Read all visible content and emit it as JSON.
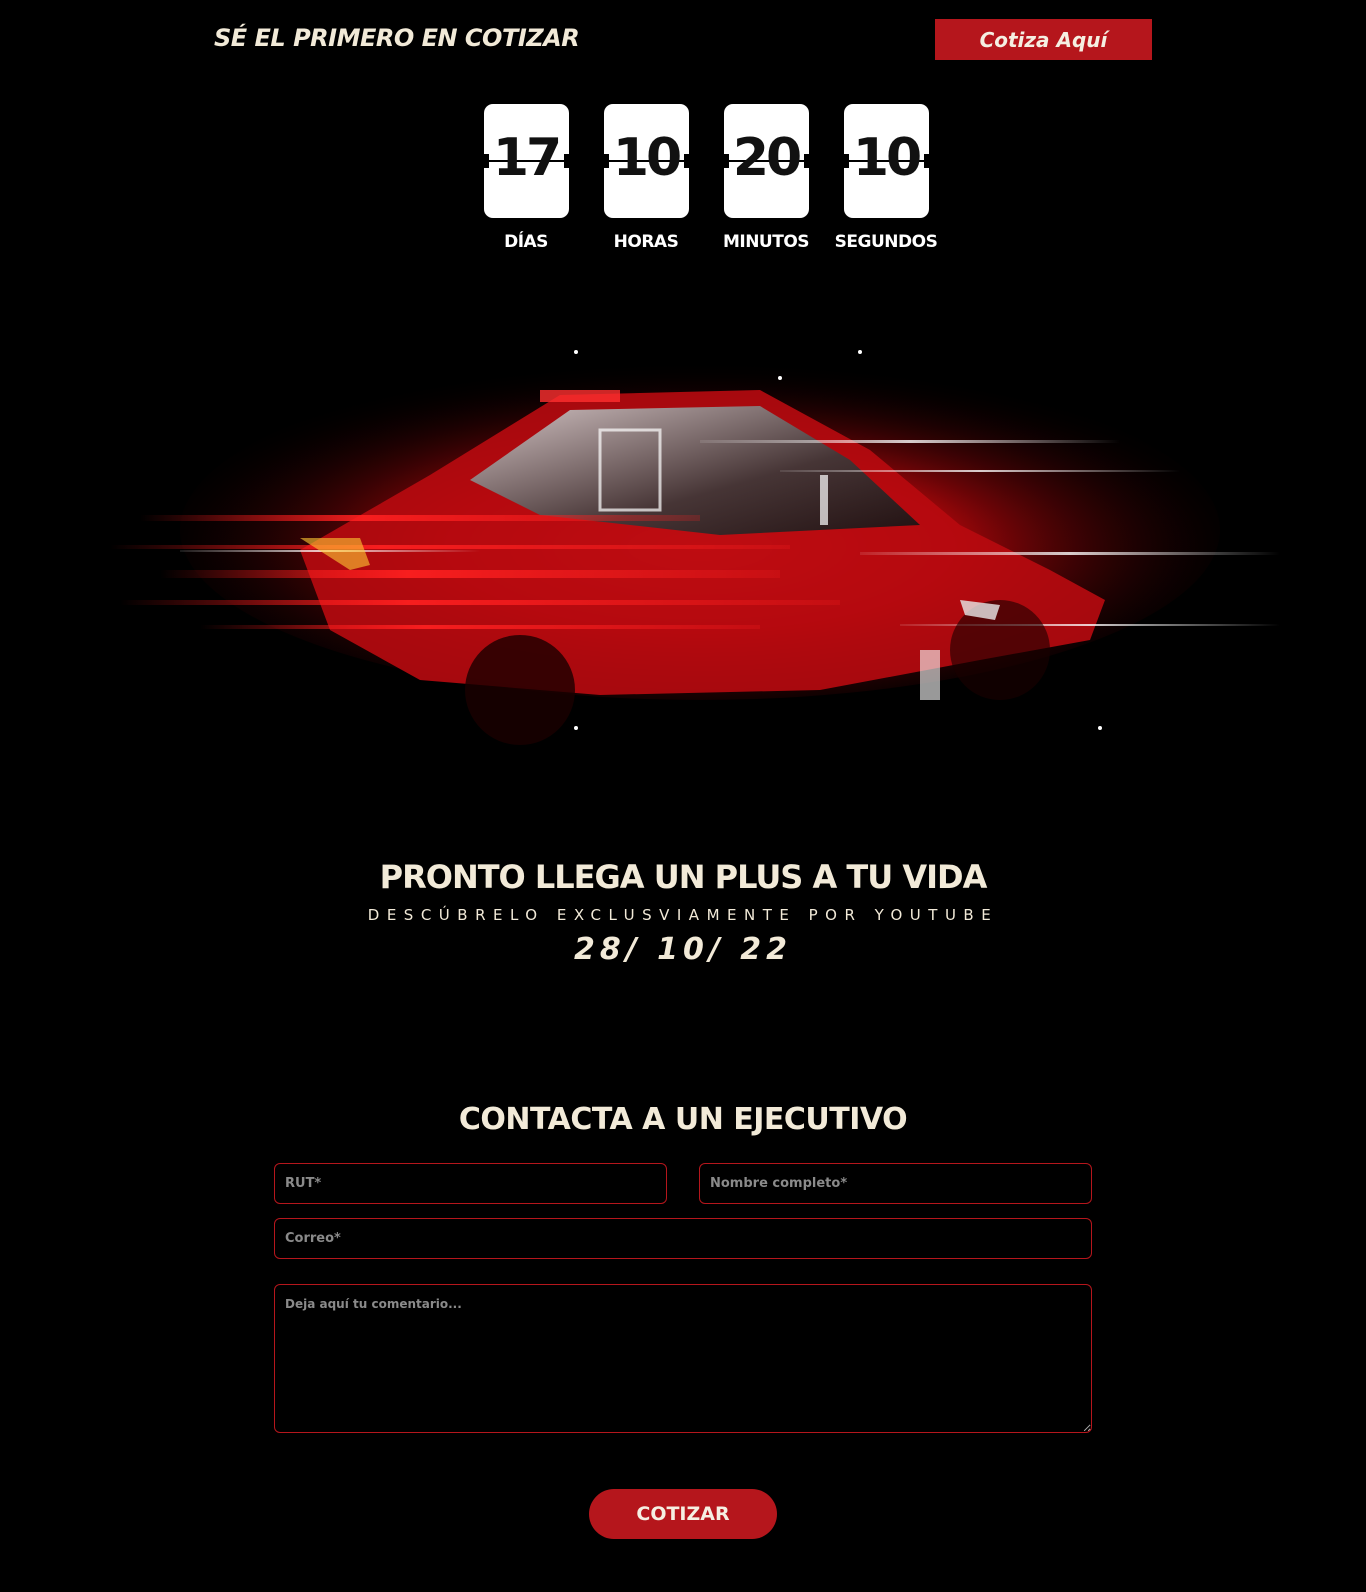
{
  "header": {
    "tagline": "SÉ EL PRIMERO EN COTIZAR",
    "cta_label": "Cotiza Aquí"
  },
  "countdown": [
    {
      "value": "17",
      "label": "DÍAS"
    },
    {
      "value": "10",
      "label": "HORAS"
    },
    {
      "value": "20",
      "label": "MINUTOS"
    },
    {
      "value": "10",
      "label": "SEGUNDOS"
    }
  ],
  "hero": {
    "image": "red-car-speed-glitch"
  },
  "promo": {
    "title": "PRONTO LLEGA UN PLUS A TU VIDA",
    "subtitle": "DESCÚBRELO EXCLUSVIAMENTE POR YOUTUBE",
    "date": "28/ 10/ 22"
  },
  "contact": {
    "title": "CONTACTA A UN EJECUTIVO",
    "rut_placeholder": "RUT*",
    "nombre_placeholder": "Nombre completo*",
    "correo_placeholder": "Correo*",
    "comment_placeholder": "Deja aquí tu comentario...",
    "submit_label": "COTIZAR"
  },
  "colors": {
    "background": "#000000",
    "accent": "#b5161c",
    "text": "#f2ead8"
  }
}
